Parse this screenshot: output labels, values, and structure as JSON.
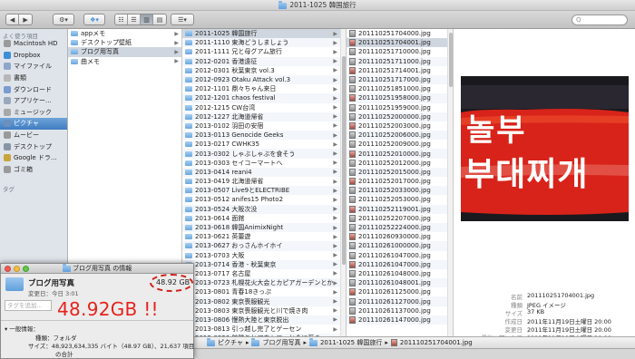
{
  "window": {
    "title": "2011-1025 韓国旅行"
  },
  "toolbar": {
    "back_icon": "◀",
    "forward_icon": "▶",
    "view_icons": [
      "☷",
      "☰",
      "▥",
      "▤"
    ],
    "search_placeholder": "Q"
  },
  "sidebar": {
    "section_devices": "よく使う項目",
    "items": [
      {
        "label": "Macintosh HD",
        "icon": "hd-icon",
        "color": "#9a9a9a"
      },
      {
        "label": "Dropbox",
        "icon": "dropbox-icon",
        "color": "#3b8ed8"
      },
      {
        "label": "マイファイル",
        "icon": "allfiles-icon",
        "color": "#8ea7c9"
      },
      {
        "label": "書類",
        "icon": "documents-icon",
        "color": "#b7b7b7"
      },
      {
        "label": "ダウンロード",
        "icon": "download-icon",
        "color": "#7b9bd1"
      },
      {
        "label": "アプリケー...",
        "icon": "applications-icon",
        "color": "#9aa8bd"
      },
      {
        "label": "ミュージック",
        "icon": "music-icon",
        "color": "#a7a7a7"
      },
      {
        "label": "ピクチャ",
        "icon": "pictures-icon",
        "color": "#6b8fbf",
        "selected": true
      },
      {
        "label": "ムービー",
        "icon": "movies-icon",
        "color": "#999"
      },
      {
        "label": "デスクトップ",
        "icon": "desktop-icon",
        "color": "#8895a7"
      },
      {
        "label": "Google ドラ...",
        "icon": "gdrive-icon",
        "color": "#c9a43b"
      },
      {
        "label": "ゴミ箱",
        "icon": "trash-icon",
        "color": "#9a9a9a"
      }
    ],
    "section_tags": "タグ"
  },
  "column1": {
    "items": [
      {
        "label": "appメモ"
      },
      {
        "label": "デスクトップ壁紙"
      },
      {
        "label": "ブログ用写真",
        "selected": true
      },
      {
        "label": "曲メモ"
      }
    ]
  },
  "column2": {
    "items": [
      "2011-1025 韓国旅行",
      "2011-1110 東海どうしましょう",
      "2011-1111 兄と母グアム旅行",
      "2012-0201 香港遠征",
      "2012-0301 秋葉東京 vol.3",
      "2012-0923 Otaku Attack vol.3",
      "2012-1101 鼎々ちゃん来日",
      "2012-1201 chaos festival",
      "2012-1215 CW台湾",
      "2012-1227 北海道帰省",
      "2013-0102 羽田の安宿",
      "2013-0113 Genocide Geeks",
      "2013-0217 CWHK35",
      "2013-0302 しゃぶしゃぶを食そう",
      "2013-0303 セイコーマートへ",
      "2013-0414 reani4",
      "2013-0419 北海道帰省",
      "2013-0507 Live9とELECTRIBE",
      "2013-0512 anifes15 Photo2",
      "2013-0524 大阪次没",
      "2013-0614 面館",
      "2013-0618 韓国AnimixNight",
      "2013-0621 英蕾遊",
      "2013-0627 おっさんホイホイ",
      "2013-0703 大阪",
      "2013-0714 香港 - 秋葉東京",
      "2013-0717 名古屋",
      "2013-0723 札幌花火大会とカピアガーデンとか",
      "2013-0801 青春18きっぷ",
      "2013-0802 東京喪服観光",
      "2013-0803 東京喪服観光と川で焼き肉",
      "2013-0806 慢熱大陸と東京脱出",
      "2013-0813 引っ越し完了とゲーセン",
      "2013-0820 鉱膳りとアウトローと今に至る"
    ]
  },
  "column3": {
    "items": [
      "201110251704000.jpg",
      "201110251704001.jpg",
      "201110251710000.jpg",
      "201110251711000.jpg",
      "201110251714001.jpg",
      "201110251717000.jpg",
      "201110251851000.jpg",
      "201110251958000.jpg",
      "201110251959000.jpg",
      "201110252000000.jpg",
      "201110252003000.jpg",
      "201110252006000.jpg",
      "201110252009000.jpg",
      "201110252010000.jpg",
      "201110252012000.jpg",
      "201110252015000.jpg",
      "201110252017000.jpg",
      "201110252033000.jpg",
      "201110252053000.jpg",
      "201110252119001.jpg",
      "201110252207000.jpg",
      "201110252224000.jpg",
      "201110260930000.jpg",
      "201110261000000.jpg",
      "201110261047000.jpg",
      "201110261047000.jpg",
      "201110261048000.jpg",
      "201110261048001.jpg",
      "201110261125000.jpg",
      "201110261127000.jpg",
      "201110261137000.jpg",
      "201110261147000.jpg"
    ],
    "selected_index": 1
  },
  "preview": {
    "sign_line1": "놀부",
    "sign_line2": "부대찌개",
    "meta": [
      {
        "key": "名前",
        "value": "201110251704001.jpg"
      },
      {
        "key": "種類",
        "value": "JPEG イメージ"
      },
      {
        "key": "サイズ",
        "value": "37 KB"
      },
      {
        "key": "作成日",
        "value": "2011年11月19日土曜日 20:00"
      },
      {
        "key": "変更日",
        "value": "2011年11月19日土曜日 20:00"
      },
      {
        "key": "最後に開いた日",
        "value": "2011年11月19日土曜日 20:00"
      },
      {
        "key": "大きさ",
        "value": "352 × 288"
      }
    ]
  },
  "pathbar": {
    "items": [
      "ピクチャ",
      "ブログ用写真",
      "2011-1025 韓国旅行",
      "201110251704001.jpg"
    ]
  },
  "info_window": {
    "title": "ブログ用写真 の情報",
    "folder_name": "ブログ用写真",
    "modified_label": "変更日：今日 3:01",
    "size_short": "48.92 GB",
    "tag_placeholder": "タグを追加...",
    "general_label": "一般情報：",
    "kind_line": "種類：フォルダ",
    "size_line": "サイズ：48,923,634,335 バイト（48.97 GB）、21,637 項目",
    "size_line2": "の合計",
    "annotation": "48.92GB !!",
    "annotation_color": "#e8221c"
  }
}
